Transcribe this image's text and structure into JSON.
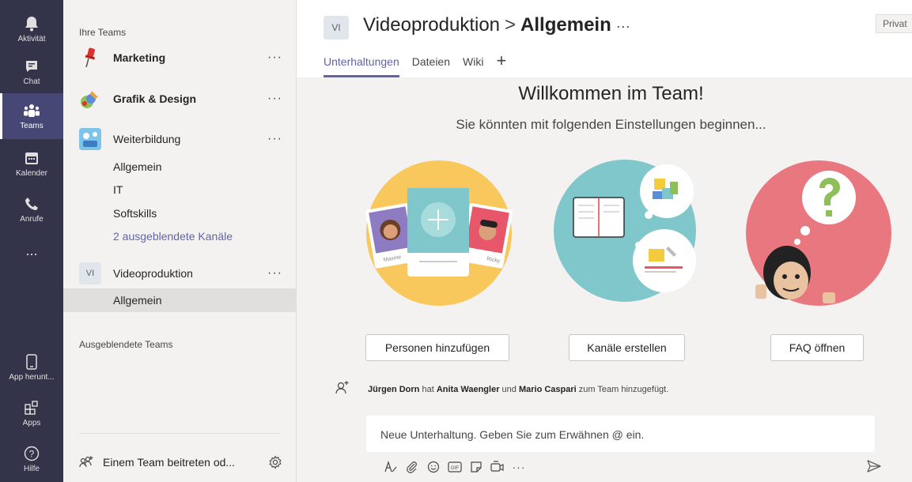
{
  "appbar": {
    "items": [
      {
        "label": "Aktivität",
        "icon": "bell-icon"
      },
      {
        "label": "Chat",
        "icon": "chat-icon"
      },
      {
        "label": "Teams",
        "icon": "teams-icon"
      },
      {
        "label": "Kalender",
        "icon": "calendar-icon"
      },
      {
        "label": "Anrufe",
        "icon": "phone-icon"
      },
      {
        "label": "...",
        "icon": "more-icon"
      }
    ],
    "bottom_items": [
      {
        "label": "App herunt...",
        "icon": "device-icon"
      },
      {
        "label": "Apps",
        "icon": "apps-icon"
      },
      {
        "label": "Hilfe",
        "icon": "help-icon"
      }
    ],
    "active": "Teams"
  },
  "teams_panel": {
    "your_teams_label": "Ihre Teams",
    "teams": [
      {
        "name": "Marketing",
        "bold": true,
        "more": "···"
      },
      {
        "name": "Grafik & Design",
        "bold": true,
        "more": "···"
      },
      {
        "name": "Weiterbildung",
        "bold": false,
        "more": "···"
      },
      {
        "name": "Videoproduktion",
        "bold": false,
        "more": "···",
        "avatar_text": "VI"
      }
    ],
    "weiterbildung_channels": [
      "Allgemein",
      "IT",
      "Softskills"
    ],
    "hidden_channels_link": "2 ausgeblendete Kanäle",
    "videoproduktion_channels": [
      "Allgemein"
    ],
    "hidden_teams_label": "Ausgeblendete Teams",
    "join_label": "Einem Team beitreten od..."
  },
  "header": {
    "badge": "VI",
    "team": "Videoproduktion",
    "separator": ">",
    "channel": "Allgemein",
    "more": "···",
    "privacy": "Privat",
    "tabs": [
      "Unterhaltungen",
      "Dateien",
      "Wiki"
    ],
    "add_tab": "+"
  },
  "welcome": {
    "title": "Willkommen im Team!",
    "subtitle": "Sie könnten mit folgenden Einstellungen beginnen...",
    "buttons": [
      "Personen hinzufügen",
      "Kanäle erstellen",
      "FAQ öffnen"
    ],
    "card_names": [
      "Maxine",
      "Ricky"
    ]
  },
  "activity": {
    "actor": "Jürgen Dorn",
    "verb1": " hat ",
    "person1": "Anita Waengler",
    "and": " und ",
    "person2": "Mario Caspari",
    "suffix": " zum Team hinzugefügt."
  },
  "compose": {
    "placeholder": "Neue Unterhaltung. Geben Sie zum Erwähnen @ ein.",
    "tools": [
      "format-icon",
      "attach-icon",
      "emoji-icon",
      "gif-icon",
      "sticker-icon",
      "meet-icon",
      "more-icon"
    ],
    "gif_label": "GIF",
    "more_label": "···"
  },
  "colors": {
    "appbar": "#33344a",
    "accent": "#6264a7",
    "yellow": "#f8c85c",
    "teal": "#80c7cb",
    "pink": "#e8777f"
  }
}
